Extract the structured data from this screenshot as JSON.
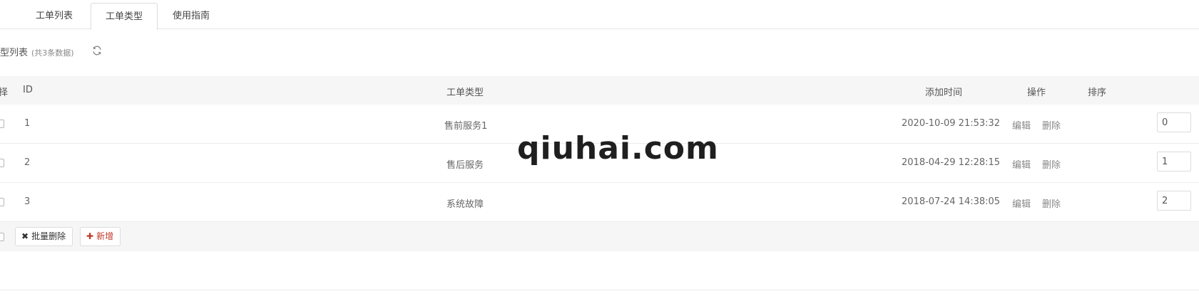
{
  "tabs": [
    {
      "label": "工单列表",
      "active": false
    },
    {
      "label": "工单类型",
      "active": true
    },
    {
      "label": "使用指南",
      "active": false
    }
  ],
  "list": {
    "title": "类型列表",
    "count_text": "(共3条数据)",
    "refresh_icon": "refresh-icon"
  },
  "table": {
    "columns": {
      "select": "择",
      "id": "ID",
      "type": "工单类型",
      "time": "添加时间",
      "ops": "操作",
      "sort": "排序"
    },
    "rows": [
      {
        "id": "1",
        "type": "售前服务1",
        "time": "2020-10-09 21:53:32",
        "edit": "编辑",
        "delete": "删除",
        "sort": "0"
      },
      {
        "id": "2",
        "type": "售后服务",
        "time": "2018-04-29 12:28:15",
        "edit": "编辑",
        "delete": "删除",
        "sort": "1"
      },
      {
        "id": "3",
        "type": "系统故障",
        "time": "2018-07-24 14:38:05",
        "edit": "编辑",
        "delete": "删除",
        "sort": "2"
      }
    ]
  },
  "footer": {
    "batch_delete_label": "批量删除",
    "batch_delete_icon": "✖",
    "add_label": "新增",
    "add_icon": "✚"
  },
  "watermark": "qiuhai.com",
  "colors": {
    "accent_red": "#c0392b",
    "header_bg": "#f6f6f6"
  }
}
